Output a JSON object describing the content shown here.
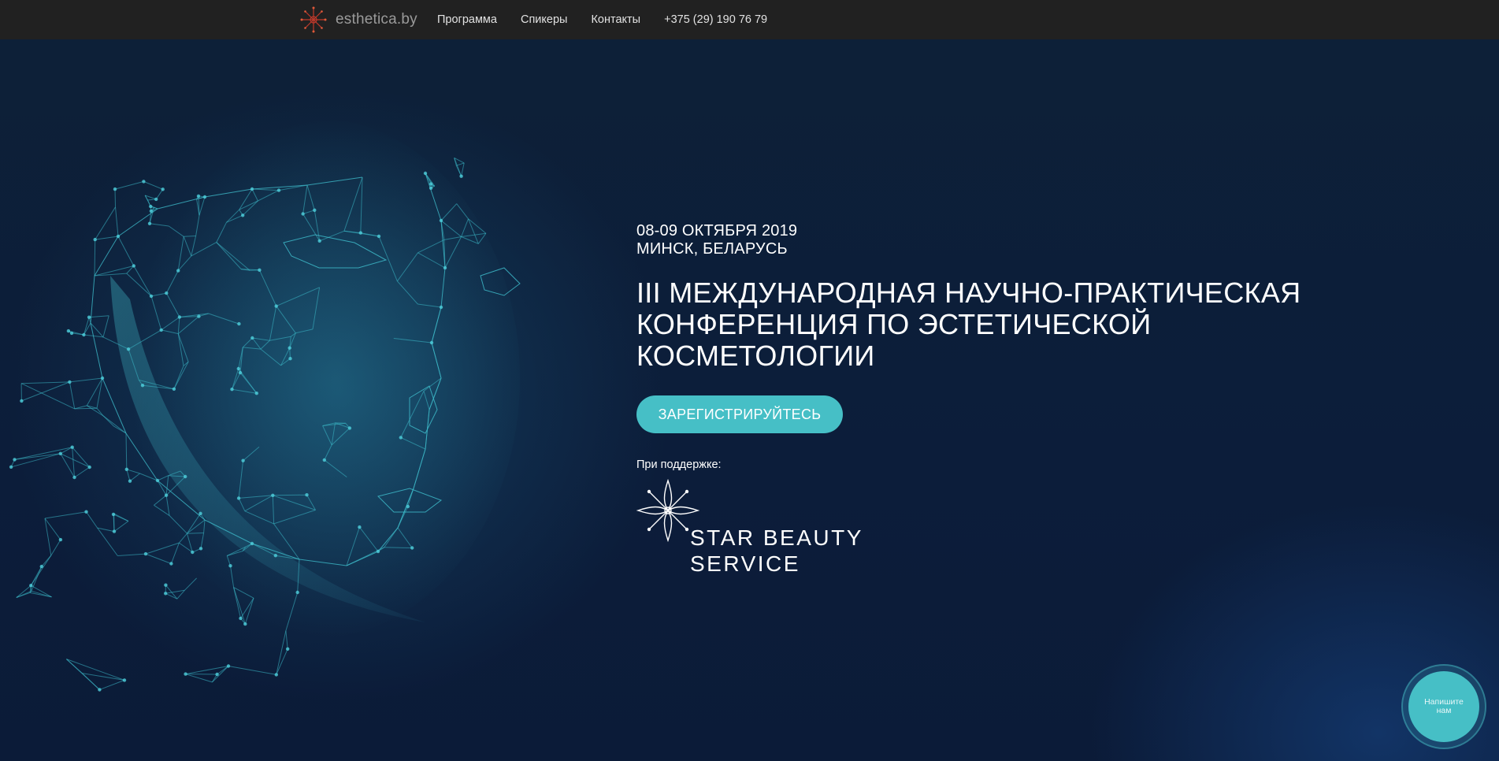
{
  "header": {
    "brand_name": "esthetica.by",
    "brand_icon": "snowflake-logo-icon",
    "nav": [
      {
        "label": "Программа"
      },
      {
        "label": "Спикеры"
      },
      {
        "label": "Контакты"
      }
    ],
    "phone": "+375 (29) 190 76 79"
  },
  "hero": {
    "date": "08-09 ОКТЯБРЯ 2019",
    "place": "МИНСК, БЕЛАРУСЬ",
    "title": "III МЕЖДУНАРОДНАЯ НАУЧНО-ПРАКТИЧЕСКАЯ КОНФЕРЕНЦИЯ ПО ЭСТЕТИЧЕСКОЙ КОСМЕТОЛОГИИ",
    "register_label": "ЗАРЕГИСТРИРУЙТЕСЬ",
    "support_label": "При поддержке:",
    "sponsor_name": "STAR  BEAUTY\nSERVICE",
    "background_art": "polygonal-face-illustration"
  },
  "chat": {
    "label": "Напишите нам"
  },
  "colors": {
    "accent": "#46bfc6",
    "topbar": "#212121",
    "background": "#0c1d38"
  }
}
